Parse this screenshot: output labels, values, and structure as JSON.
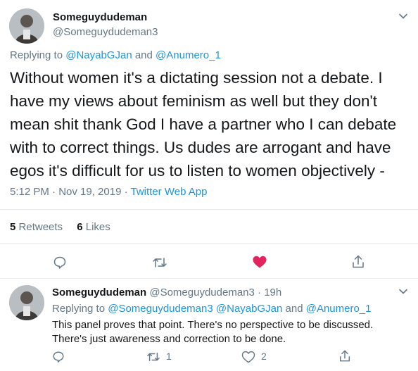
{
  "tweet": {
    "author_name": "Someguydudeman",
    "author_handle": "@Someguydudeman3",
    "replying_prefix": "Replying to",
    "replying_user1": "@NayabGJan",
    "replying_and": "and",
    "replying_user2": "@Anumero_1",
    "text": "Without women it's a dictating session not a debate. I have my views about feminism as well but they don't mean shit thank God I have a partner who I can debate with to correct things. Us dudes are arrogant and have egos it's difficult for us to listen to women objectively -",
    "time": "5:12 PM · Nov 19, 2019 ·",
    "source": "Twitter Web App",
    "retweets_count": "5",
    "retweets_label": "Retweets",
    "likes_count": "6",
    "likes_label": "Likes"
  },
  "reply": {
    "author_name": "Someguydudeman",
    "author_handle": "@Someguydudeman3",
    "time": "· 19h",
    "replying_prefix": "Replying to",
    "replying_user1": "@Someguydudeman3",
    "replying_user2": "@NayabGJan",
    "replying_and": "and",
    "replying_user3": "@Anumero_1",
    "text_line1": "This panel proves that point. There's no perspective to be discussed.",
    "text_line2": "There's just awareness and correction to be done.",
    "retweet_count": "1",
    "like_count": "2"
  },
  "icons": {
    "chevron": "chevron-down-icon",
    "reply": "reply-bubble-icon",
    "retweet": "retweet-icon",
    "like": "heart-icon",
    "share": "share-icon"
  },
  "colors": {
    "link": "#1b95e0",
    "like_active": "#e0245e",
    "muted": "#657786"
  }
}
